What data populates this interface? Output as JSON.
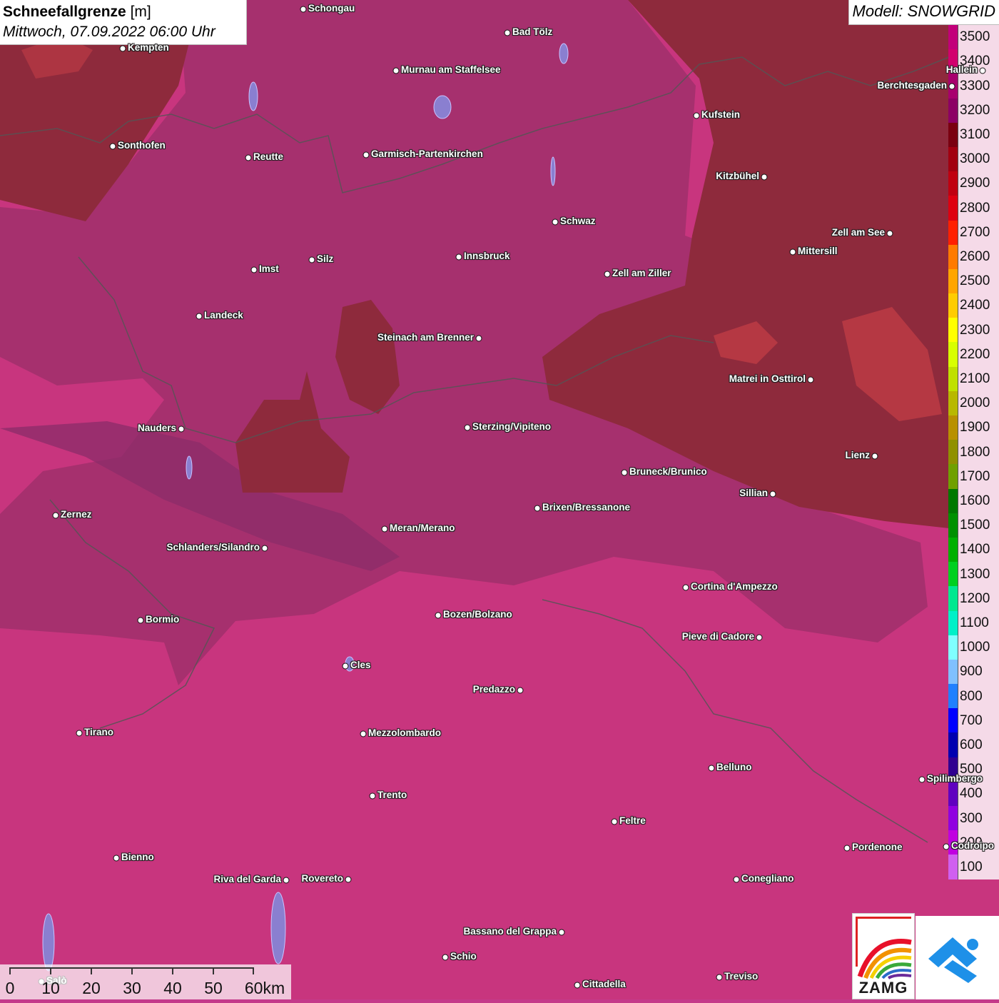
{
  "header": {
    "title_bold": "Schneefallgrenze",
    "title_unit": "[m]",
    "subtitle": "Mittwoch, 07.09.2022 06:00 Uhr",
    "model": "Modell: SNOWGRID"
  },
  "colors": {
    "zone_3300": "#a6306e",
    "zone_3100": "#8e2a3c",
    "zone_3400": "#c8357e",
    "zone_3200": "#8b2c6a",
    "zone_2800": "#c23e46"
  },
  "legend": {
    "labels": [
      "3500",
      "3400",
      "3300",
      "3200",
      "3100",
      "3000",
      "2900",
      "2800",
      "2700",
      "2600",
      "2500",
      "2400",
      "2300",
      "2200",
      "2100",
      "2000",
      "1900",
      "1800",
      "1700",
      "1600",
      "1500",
      "1400",
      "1300",
      "1200",
      "1100",
      "1000",
      "900",
      "800",
      "700",
      "600",
      "500",
      "400",
      "300",
      "200",
      "100"
    ],
    "colors": [
      "#c2007a",
      "#d2006e",
      "#a8006e",
      "#8c0064",
      "#7a0010",
      "#a20010",
      "#c00010",
      "#de0010",
      "#ff2000",
      "#ff7a00",
      "#ffa500",
      "#ffcc00",
      "#ffff00",
      "#d8ff00",
      "#c0e000",
      "#b8b800",
      "#b89000",
      "#909000",
      "#70a000",
      "#007800",
      "#009000",
      "#00b000",
      "#00d020",
      "#00e890",
      "#00f0c8",
      "#80ffff",
      "#80c0ff",
      "#2080ff",
      "#0000ff",
      "#0000b0",
      "#300090",
      "#6000c0",
      "#9000e0",
      "#c000e0",
      "#d060f0"
    ]
  },
  "scale": {
    "ticks": [
      "0",
      "10",
      "20",
      "30",
      "40",
      "50",
      "60km"
    ]
  },
  "cities": [
    {
      "name": "Schongau"
    },
    {
      "name": "Bad Tölz"
    },
    {
      "name": "Kempten"
    },
    {
      "name": "Murnau am Staffelsee"
    },
    {
      "name": "Hallein"
    },
    {
      "name": "Berchtesgaden"
    },
    {
      "name": "Kufstein"
    },
    {
      "name": "Sonthofen"
    },
    {
      "name": "Reutte"
    },
    {
      "name": "Garmisch-Partenkirchen"
    },
    {
      "name": "Kitzbühel"
    },
    {
      "name": "Schwaz"
    },
    {
      "name": "Zell am See"
    },
    {
      "name": "Mittersill"
    },
    {
      "name": "Innsbruck"
    },
    {
      "name": "Silz"
    },
    {
      "name": "Imst"
    },
    {
      "name": "Zell am Ziller"
    },
    {
      "name": "Landeck"
    },
    {
      "name": "Steinach am Brenner"
    },
    {
      "name": "Matrei in Osttirol"
    },
    {
      "name": "Nauders"
    },
    {
      "name": "Sterzing/Vipiteno"
    },
    {
      "name": "Lienz"
    },
    {
      "name": "Bruneck/Brunico"
    },
    {
      "name": "Sillian"
    },
    {
      "name": "Brixen/Bressanone"
    },
    {
      "name": "Zernez"
    },
    {
      "name": "Meran/Merano"
    },
    {
      "name": "Schlanders/Silandro"
    },
    {
      "name": "Cortina d'Ampezzo"
    },
    {
      "name": "Bozen/Bolzano"
    },
    {
      "name": "Bormio"
    },
    {
      "name": "Pieve di Cadore"
    },
    {
      "name": "Cles"
    },
    {
      "name": "Predazzo"
    },
    {
      "name": "Tirano"
    },
    {
      "name": "Mezzolombardo"
    },
    {
      "name": "Belluno"
    },
    {
      "name": "Spilimbergo"
    },
    {
      "name": "Trento"
    },
    {
      "name": "Feltre"
    },
    {
      "name": "Pordenone"
    },
    {
      "name": "Codroipo"
    },
    {
      "name": "Bienno"
    },
    {
      "name": "Riva del Garda"
    },
    {
      "name": "Rovereto"
    },
    {
      "name": "Conegliano"
    },
    {
      "name": "Bassano del Grappa"
    },
    {
      "name": "Schio"
    },
    {
      "name": "Treviso"
    },
    {
      "name": "Cittadella"
    },
    {
      "name": "Salò"
    }
  ],
  "logo": {
    "text": "ZAMG"
  }
}
